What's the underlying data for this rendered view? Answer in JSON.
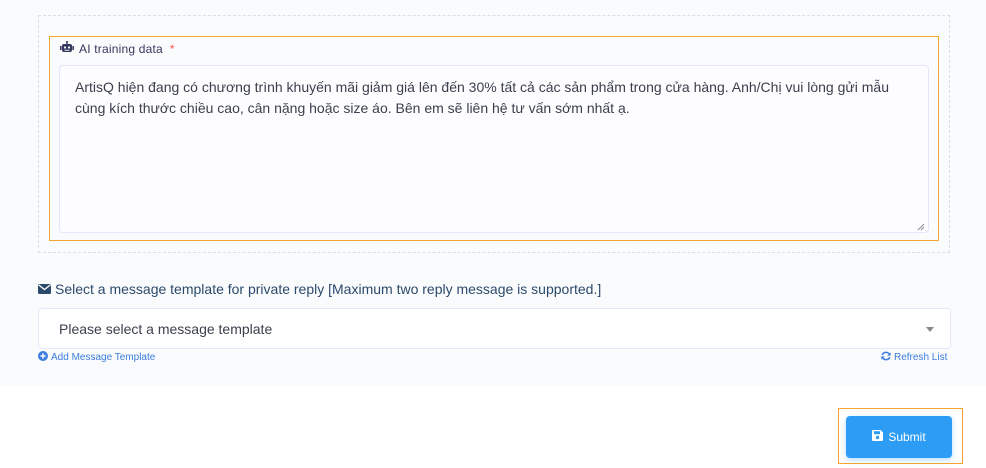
{
  "ai_training": {
    "label": "AI training data",
    "required_mark": "*",
    "value": "ArtisQ hiện đang có chương trình khuyến mãi giảm giá lên đến 30% tất cả các sản phẩm trong cửa hàng. Anh/Chị vui lòng gửi mẫu cùng kích thước chiều cao, cân nặng hoặc size áo. Bên em sẽ liên hệ tư vấn sớm nhất ạ."
  },
  "template": {
    "label": "Select a message template for private reply [Maximum two reply message is supported.]",
    "select_value": "Please select a message template",
    "add_link": "Add Message Template",
    "refresh_link": "Refresh List"
  },
  "actions": {
    "submit_label": "Submit"
  },
  "icons": {
    "robot": "robot-icon",
    "envelope": "envelope-icon",
    "plus_circle": "plus-circle-icon",
    "refresh": "refresh-icon",
    "save": "save-icon"
  },
  "colors": {
    "highlight_border": "#f3a531",
    "primary_button": "#2c9cf5",
    "link": "#3b7ddd",
    "required": "#fc544b"
  }
}
